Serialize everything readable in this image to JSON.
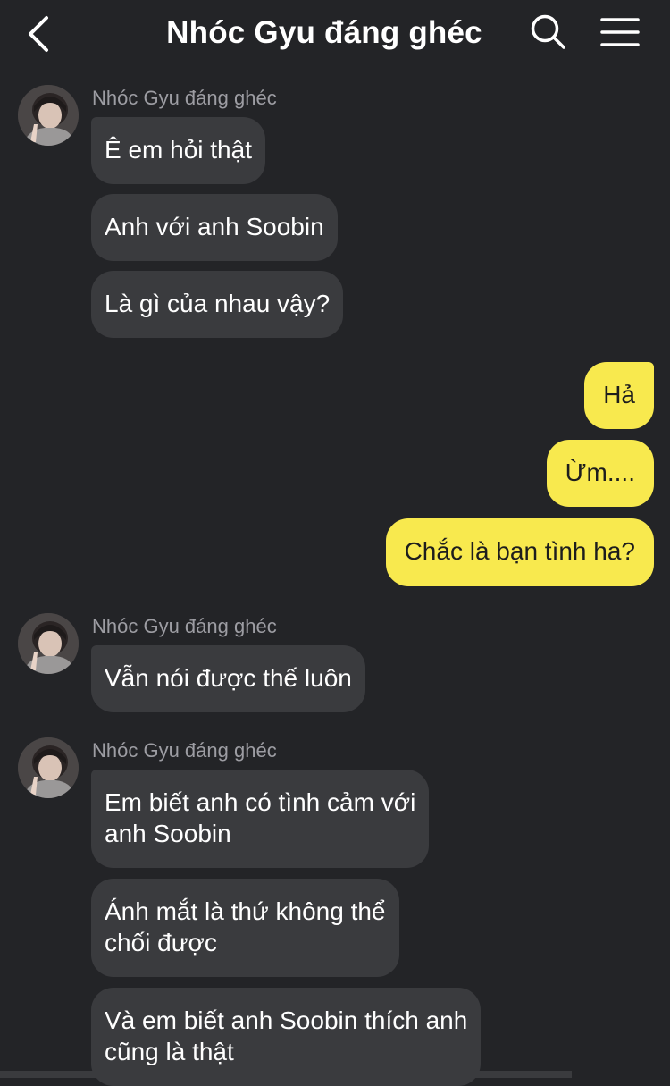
{
  "header": {
    "title": "Nhóc Gyu đáng ghéc",
    "back_icon": "chevron-left-icon",
    "search_icon": "search-icon",
    "menu_icon": "hamburger-menu-icon"
  },
  "colors": {
    "background": "#232427",
    "incoming_bubble": "#3a3b3e",
    "outgoing_bubble": "#f8e94e",
    "sender_name": "#9d9da3"
  },
  "messages": {
    "group1": {
      "sender": "Nhóc Gyu đáng ghéc",
      "m1": "Ê em hỏi thật",
      "m2": "Anh với anh Soobin",
      "m3": "Là gì của nhau vậy?"
    },
    "outgoing": {
      "m1": "Hả",
      "m2": "Ừm....",
      "m3": "Chắc là bạn tình ha?"
    },
    "group2": {
      "sender": "Nhóc Gyu đáng ghéc",
      "m1": "Vẫn nói được thế luôn"
    },
    "group3": {
      "sender": "Nhóc Gyu đáng ghéc",
      "m1_line1": "Em biết anh có tình cảm với",
      "m1_line2": "anh Soobin",
      "m2_line1": "Ánh mắt là thứ không thể",
      "m2_line2": "chối được",
      "m3_line1": "Và em biết anh Soobin thích anh",
      "m3_line2": "cũng là thật"
    }
  }
}
